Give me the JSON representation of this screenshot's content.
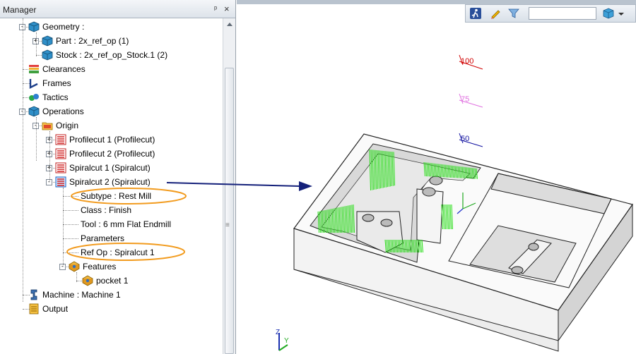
{
  "manager": {
    "title": "Manager",
    "pin_glyph": "ᵖ",
    "close_glyph": "×"
  },
  "tree": [
    {
      "label": "Geometry :",
      "icon": "geometry-icon",
      "depth": 1,
      "expander": "-"
    },
    {
      "label": "Part : 2x_ref_op (1)",
      "icon": "part-icon",
      "depth": 2,
      "expander": "+"
    },
    {
      "label": "Stock : 2x_ref_op_Stock.1 (2)",
      "icon": "stock-icon",
      "depth": 2,
      "expander": ""
    },
    {
      "label": "Clearances",
      "icon": "clearances-icon",
      "depth": 1,
      "expander": ""
    },
    {
      "label": "Frames",
      "icon": "frames-icon",
      "depth": 1,
      "expander": ""
    },
    {
      "label": "Tactics",
      "icon": "tactics-icon",
      "depth": 1,
      "expander": ""
    },
    {
      "label": "Operations",
      "icon": "operations-icon",
      "depth": 1,
      "expander": "-"
    },
    {
      "label": "Origin",
      "icon": "folder-icon",
      "depth": 2,
      "expander": "-"
    },
    {
      "label": "Profilecut 1 (Profilecut)",
      "icon": "toolpath-icon",
      "depth": 3,
      "expander": "+"
    },
    {
      "label": "Profilecut 2 (Profilecut)",
      "icon": "toolpath-icon",
      "depth": 3,
      "expander": "+"
    },
    {
      "label": "Spiralcut 1 (Spiralcut)",
      "icon": "toolpath-icon",
      "depth": 3,
      "expander": "+"
    },
    {
      "label": "Spiralcut 2 (Spiralcut)",
      "icon": "toolpath-active-icon",
      "depth": 3,
      "expander": "-"
    },
    {
      "label": "Subtype : Rest Mill",
      "icon": "",
      "depth": 4,
      "expander": ""
    },
    {
      "label": "Class : Finish",
      "icon": "",
      "depth": 4,
      "expander": ""
    },
    {
      "label": "Tool : 6 mm Flat Endmill",
      "icon": "",
      "depth": 4,
      "expander": ""
    },
    {
      "label": "Parameters",
      "icon": "",
      "depth": 4,
      "expander": ""
    },
    {
      "label": "Ref Op : Spiralcut 1",
      "icon": "",
      "depth": 4,
      "expander": ""
    },
    {
      "label": "Features",
      "icon": "features-icon",
      "depth": 4,
      "expander": "-"
    },
    {
      "label": "pocket 1",
      "icon": "pocket-icon",
      "depth": 5,
      "expander": ""
    },
    {
      "label": "Machine : Machine 1",
      "icon": "machine-icon",
      "depth": 1,
      "expander": ""
    },
    {
      "label": "Output",
      "icon": "output-icon",
      "depth": 1,
      "expander": ""
    }
  ],
  "highlights": [
    "Subtype : Rest Mill",
    "Ref Op : Spiralcut 1"
  ],
  "viewport": {
    "toolbar_icons": [
      "run-icon",
      "pencil-icon",
      "filter-icon",
      "view-cube-icon",
      "dropdown-icon"
    ],
    "search_value": "",
    "height_markers": [
      "100",
      "75",
      "50"
    ],
    "triad_labels": {
      "z": "Z",
      "y": "Y"
    }
  },
  "colors": {
    "highlight_ellipse": "#f29b1e",
    "arrow": "#14207a",
    "toolpath": "#22dd11",
    "marker_100": "#d00000",
    "marker_75": "#e070e0",
    "marker_50": "#1010a0"
  }
}
